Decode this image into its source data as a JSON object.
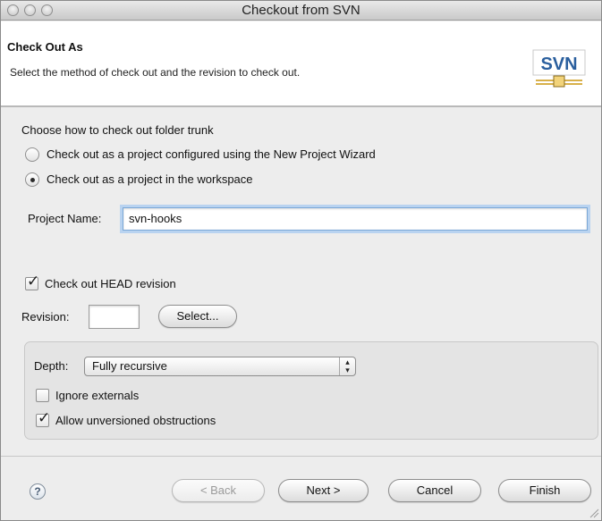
{
  "window": {
    "title": "Checkout from SVN"
  },
  "banner": {
    "title": "Check Out As",
    "description": "Select the method of check out and the revision to check out.",
    "logo_text": "SVN"
  },
  "method": {
    "heading": "Choose how to check out folder trunk",
    "options": [
      {
        "label": "Check out as a project configured using the New Project Wizard",
        "selected": false
      },
      {
        "label": "Check out as a project in the workspace",
        "selected": true
      }
    ]
  },
  "project": {
    "label": "Project Name:",
    "value": "svn-hooks"
  },
  "revision": {
    "head_label": "Check out HEAD revision",
    "head_checked": true,
    "label": "Revision:",
    "value": "",
    "select_button": "Select..."
  },
  "options": {
    "depth_label": "Depth:",
    "depth_value": "Fully recursive",
    "ignore_externals_label": "Ignore externals",
    "ignore_externals_checked": false,
    "allow_unversioned_label": "Allow unversioned obstructions",
    "allow_unversioned_checked": true
  },
  "footer": {
    "help": "?",
    "back": "< Back",
    "next": "Next >",
    "cancel": "Cancel",
    "finish": "Finish"
  },
  "colors": {
    "accent_focus": "#7aa7d6",
    "logo_blue": "#2a5f9e",
    "logo_gold": "#d8b04a"
  }
}
